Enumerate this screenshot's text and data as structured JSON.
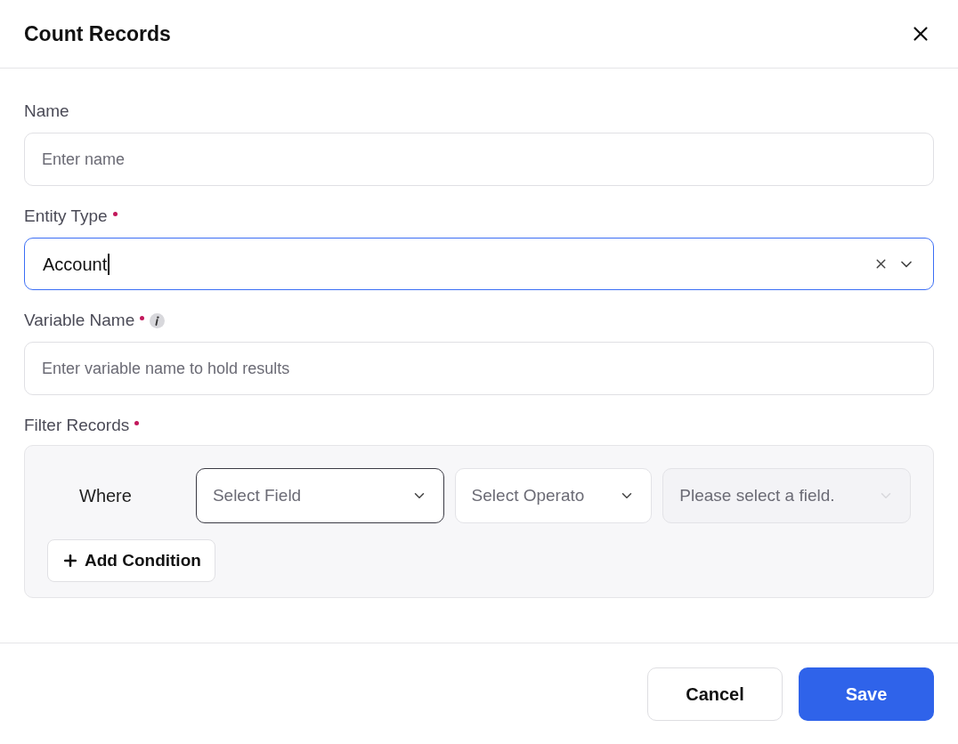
{
  "dialog": {
    "title": "Count Records"
  },
  "fields": [
    {
      "kind": "text",
      "label": "Name",
      "placeholder": "Enter name",
      "focused": false
    },
    {
      "kind": "select",
      "label": "Entity Type",
      "required": true,
      "value": "Account",
      "focused": true
    },
    {
      "kind": "text",
      "label": "Variable Name",
      "required": true,
      "info": true,
      "placeholder": "Enter variable name to hold results",
      "focused": false
    }
  ],
  "filter": {
    "label": "Filter Records",
    "required": true,
    "where": "Where",
    "selects": [
      {
        "placeholder": "Select Field",
        "focused": true,
        "disabled": false
      },
      {
        "placeholder": "Select Operato",
        "focused": false,
        "disabled": false
      },
      {
        "placeholder": "Please select a field.",
        "focused": false,
        "disabled": true
      }
    ],
    "add_button": "Add Condition"
  },
  "buttons": [
    {
      "label": "Cancel",
      "kind": "secondary"
    },
    {
      "label": "Save",
      "kind": "primary"
    }
  ]
}
